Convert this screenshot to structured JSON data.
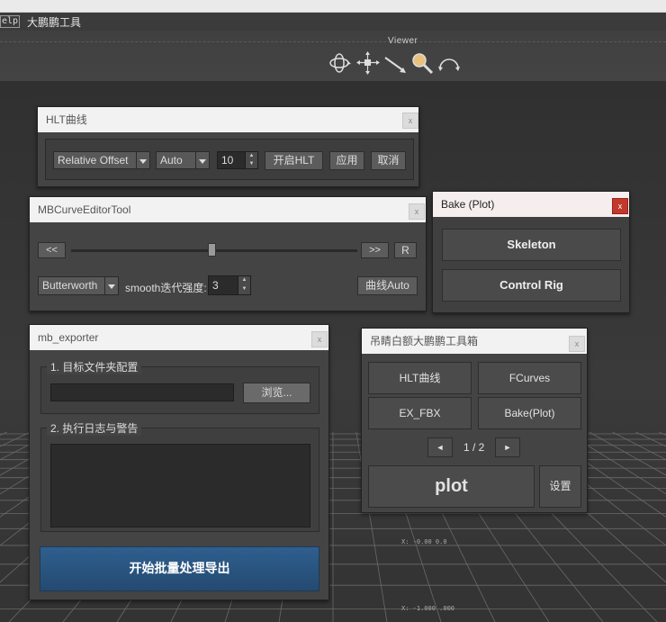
{
  "menubar": {
    "help_label": "elp",
    "tool_label": "大鹏鹏工具"
  },
  "viewer": {
    "label": "Viewer",
    "icons": [
      "orbit-icon",
      "pan-icon",
      "dolly-icon",
      "zoom-icon",
      "undo-view-icon"
    ]
  },
  "hud": {
    "line1": "X: -0.00 0.0",
    "line2": "X: -1.000 .000"
  },
  "hlt_panel": {
    "title": "HLT曲线",
    "close": "x",
    "mode_value": "Relative Offset",
    "auto_value": "Auto",
    "spin_value": "10",
    "open_label": "开启HLT",
    "apply_label": "应用",
    "cancel_label": "取消"
  },
  "mbcurve_panel": {
    "title": "MBCurveEditorTool",
    "close": "x",
    "prev_label": "<<",
    "next_label": ">>",
    "reset_label": "R",
    "slider_value": 0.49,
    "filter_value": "Butterworth",
    "smooth_label": "smooth迭代强度:",
    "smooth_value": "3",
    "auto_label": "曲线Auto"
  },
  "bake_panel": {
    "title": "Bake (Plot)",
    "close": "x",
    "skeleton_label": "Skeleton",
    "controlrig_label": "Control Rig",
    "accent": "#c0392b"
  },
  "exporter_panel": {
    "title": "mb_exporter",
    "close": "x",
    "group1_title": "1. 目标文件夹配置",
    "path_value": "",
    "browse_label": "浏览...",
    "group2_title": "2. 执行日志与警告",
    "log_value": "",
    "export_label": "开始批量处理导出",
    "accent": "#2f5f8f"
  },
  "toolbox_panel": {
    "title": "吊睛白额大鹏鹏工具箱",
    "close": "x",
    "buttons": [
      "HLT曲线",
      "FCurves",
      "EX_FBX",
      "Bake(Plot)"
    ],
    "prev_label": "◄",
    "page_label": "1 / 2",
    "next_label": "►",
    "plot_label": "plot",
    "settings_label": "设置"
  }
}
